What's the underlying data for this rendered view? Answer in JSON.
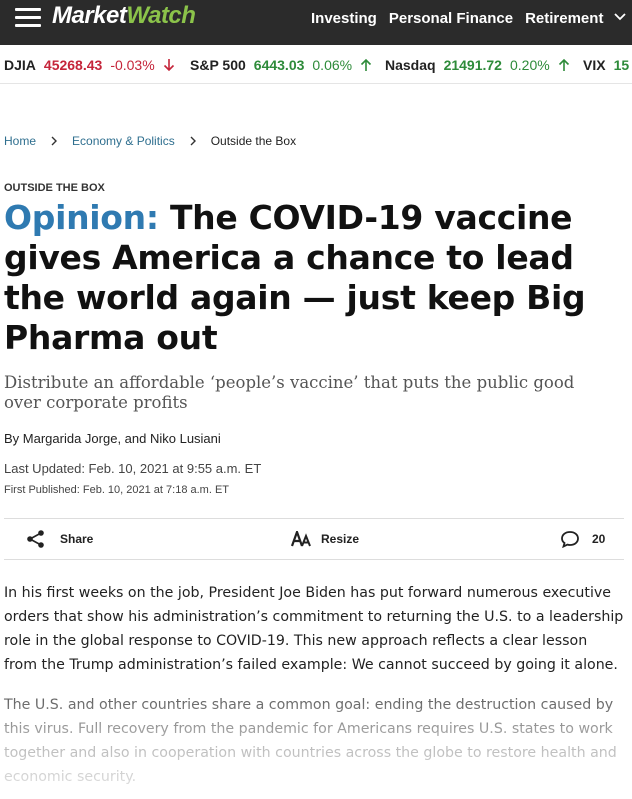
{
  "header": {
    "logo_market": "Market",
    "logo_watch": "Watch",
    "nav": [
      "Investing",
      "Personal Finance",
      "Retirement"
    ]
  },
  "ticker": [
    {
      "symbol": "DJIA",
      "value": "45268.43",
      "change": "-0.03%",
      "direction": "down"
    },
    {
      "symbol": "S&P 500",
      "value": "6443.03",
      "change": "0.06%",
      "direction": "up"
    },
    {
      "symbol": "Nasdaq",
      "value": "21491.72",
      "change": "0.20%",
      "direction": "up"
    },
    {
      "symbol": "VIX",
      "value": "15"
    }
  ],
  "breadcrumb": {
    "home": "Home",
    "section": "Economy & Politics",
    "current": "Outside the Box"
  },
  "article": {
    "kicker": "OUTSIDE THE BOX",
    "opinion_label": "Opinion:",
    "headline": "The COVID-19 vaccine gives America a chance to lead the world again — just keep Big Pharma out",
    "dek": "Distribute an affordable ‘people’s vaccine’ that puts the public good over corporate profits",
    "byline": "By Margarida Jorge, and Niko Lusiani",
    "last_updated": "Last Updated: Feb. 10, 2021 at 9:55 a.m. ET",
    "first_published": "First Published: Feb. 10, 2021 at 7:18 a.m. ET",
    "paragraphs": [
      "In his first weeks on the job, President Joe Biden has put forward numerous executive orders that show his administration’s commitment to returning the U.S. to a leadership role in the global response to COVID-19. This new approach reflects a clear lesson from the Trump administration’s failed example: We cannot succeed by going it alone.",
      "The U.S. and other countries share a common goal: ending the destruction caused by this virus. Full recovery from the pandemic for Americans requires U.S. states to work together and also in cooperation with countries across the globe to restore health and economic security."
    ]
  },
  "sharebar": {
    "share_label": "Share",
    "resize_label": "Resize",
    "comment_count": "20"
  },
  "colors": {
    "topbar": "#2b2b2b",
    "logo_watch": "#8bc34a",
    "opinion": "#2f7ab1",
    "down": "#c5253a",
    "up": "#2e8b3a",
    "link": "#2f6f8f"
  },
  "icons": [
    "hamburger-menu-icon",
    "chevron-down-icon",
    "arrow-down-icon",
    "arrow-up-icon",
    "chevron-right-icon",
    "share-icon",
    "resize-text-icon",
    "comment-icon"
  ]
}
